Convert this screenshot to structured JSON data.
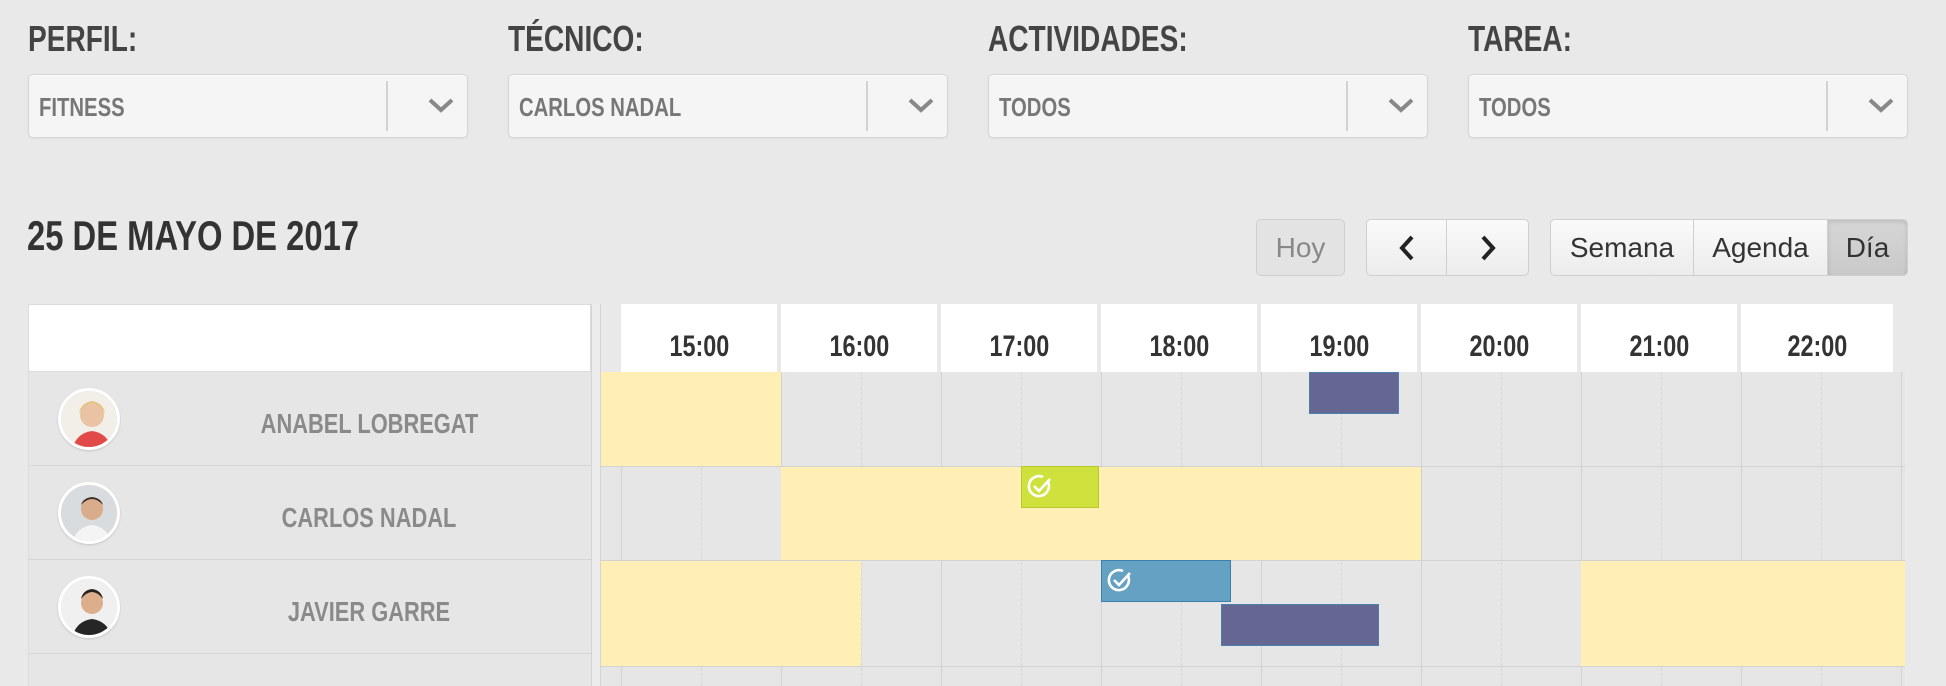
{
  "filters": [
    {
      "label": "PERFIL:",
      "value": "FITNESS"
    },
    {
      "label": "TÉCNICO:",
      "value": "CARLOS NADAL"
    },
    {
      "label": "ACTIVIDADES:",
      "value": "TODOS"
    },
    {
      "label": "TAREA:",
      "value": "TODOS"
    }
  ],
  "calendar": {
    "date_title": "25 DE MAYO DE 2017",
    "today_label": "Hoy",
    "views": {
      "week": "Semana",
      "agenda": "Agenda",
      "day": "Día"
    },
    "active_view": "Día",
    "hours": [
      "15:00",
      "16:00",
      "17:00",
      "18:00",
      "19:00",
      "20:00",
      "21:00",
      "22:00"
    ],
    "resources": [
      {
        "name": "ANABEL LOBREGAT"
      },
      {
        "name": "CARLOS NADAL"
      },
      {
        "name": "JAVIER GARRE"
      }
    ]
  },
  "colors": {
    "availability": "#ffefb5",
    "event_purple": "#656792",
    "event_blue": "#65a1c3",
    "event_green": "#cfe13c"
  },
  "icons": {
    "dropdown": "chevron-down-icon",
    "prev": "chevron-left-icon",
    "next": "chevron-right-icon",
    "completed": "check-circle-icon"
  }
}
